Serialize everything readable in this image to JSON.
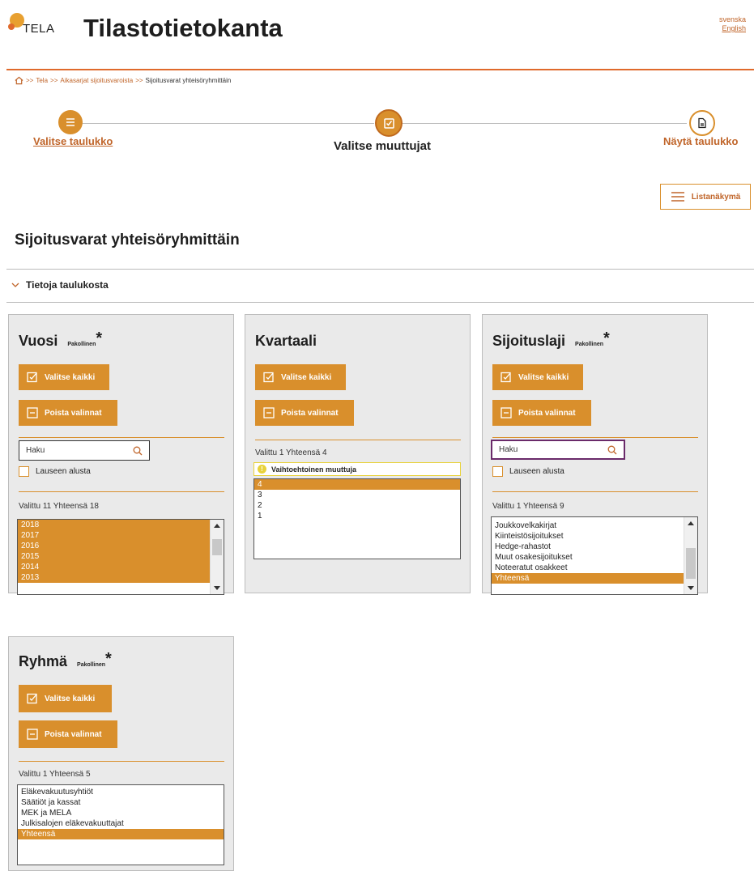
{
  "header": {
    "logo_text": "TELA",
    "site_title": "Tilastotietokanta",
    "languages": [
      "svenska",
      "English"
    ]
  },
  "breadcrumb": {
    "items": [
      "Tela",
      "Aikasarjat sijoitusvaroista"
    ],
    "current": "Sijoitusvarat yhteisöryhmittäin",
    "separator": ">>"
  },
  "steps": [
    {
      "label": "Valitse taulukko",
      "state": "done",
      "icon": "list-icon"
    },
    {
      "label": "Valitse muuttujat",
      "state": "active",
      "icon": "checkbox-icon"
    },
    {
      "label": "Näytä taulukko",
      "state": "todo",
      "icon": "document-icon"
    }
  ],
  "list_view_button": "Listanäkymä",
  "page_title": "Sijoitusvarat yhteisöryhmittäin",
  "info_toggle": "Tietoja taulukosta",
  "labels": {
    "select_all": "Valitse kaikki",
    "clear": "Poista valinnat",
    "required": "Pakollinen",
    "star": "*",
    "search_placeholder": "Haku",
    "from_start": "Lauseen alusta"
  },
  "panels": {
    "vuosi": {
      "title": "Vuosi",
      "count": "Valittu 11 Yhteensä 18",
      "options": [
        {
          "label": "2018",
          "selected": true
        },
        {
          "label": "2017",
          "selected": true
        },
        {
          "label": "2016",
          "selected": true
        },
        {
          "label": "2015",
          "selected": true
        },
        {
          "label": "2014",
          "selected": true
        },
        {
          "label": "2013",
          "selected": true
        }
      ]
    },
    "kvartaali": {
      "title": "Kvartaali",
      "count": "Valittu 1 Yhteensä 4",
      "alt_variable": "Vaihtoehtoinen muuttuja",
      "options": [
        {
          "label": "4",
          "selected": true
        },
        {
          "label": "3",
          "selected": false
        },
        {
          "label": "2",
          "selected": false
        },
        {
          "label": "1",
          "selected": false
        }
      ]
    },
    "sijoituslaji": {
      "title": "Sijoituslaji",
      "count": "Valittu 1 Yhteensä 9",
      "options": [
        {
          "label": "Joukkovelkakirjat",
          "selected": false
        },
        {
          "label": "Kiinteistösijoitukset",
          "selected": false
        },
        {
          "label": "Hedge-rahastot",
          "selected": false
        },
        {
          "label": "Muut osakesijoitukset",
          "selected": false
        },
        {
          "label": "Noteeratut osakkeet",
          "selected": false
        },
        {
          "label": "Yhteensä",
          "selected": true
        }
      ]
    },
    "ryhma": {
      "title": "Ryhmä",
      "count": "Valittu 1 Yhteensä 5",
      "options": [
        {
          "label": "Eläkevakuutusyhtiöt",
          "selected": false
        },
        {
          "label": "Säätiöt ja kassat",
          "selected": false
        },
        {
          "label": "MEK ja MELA",
          "selected": false
        },
        {
          "label": "Julkisalojen eläkevakuuttajat",
          "selected": false
        },
        {
          "label": "Yhteensä",
          "selected": true
        }
      ]
    }
  },
  "colors": {
    "accent": "#d98f2c",
    "link": "#c0652a",
    "header_rule": "#e06a2c",
    "panel_bg": "#eaeaea"
  }
}
